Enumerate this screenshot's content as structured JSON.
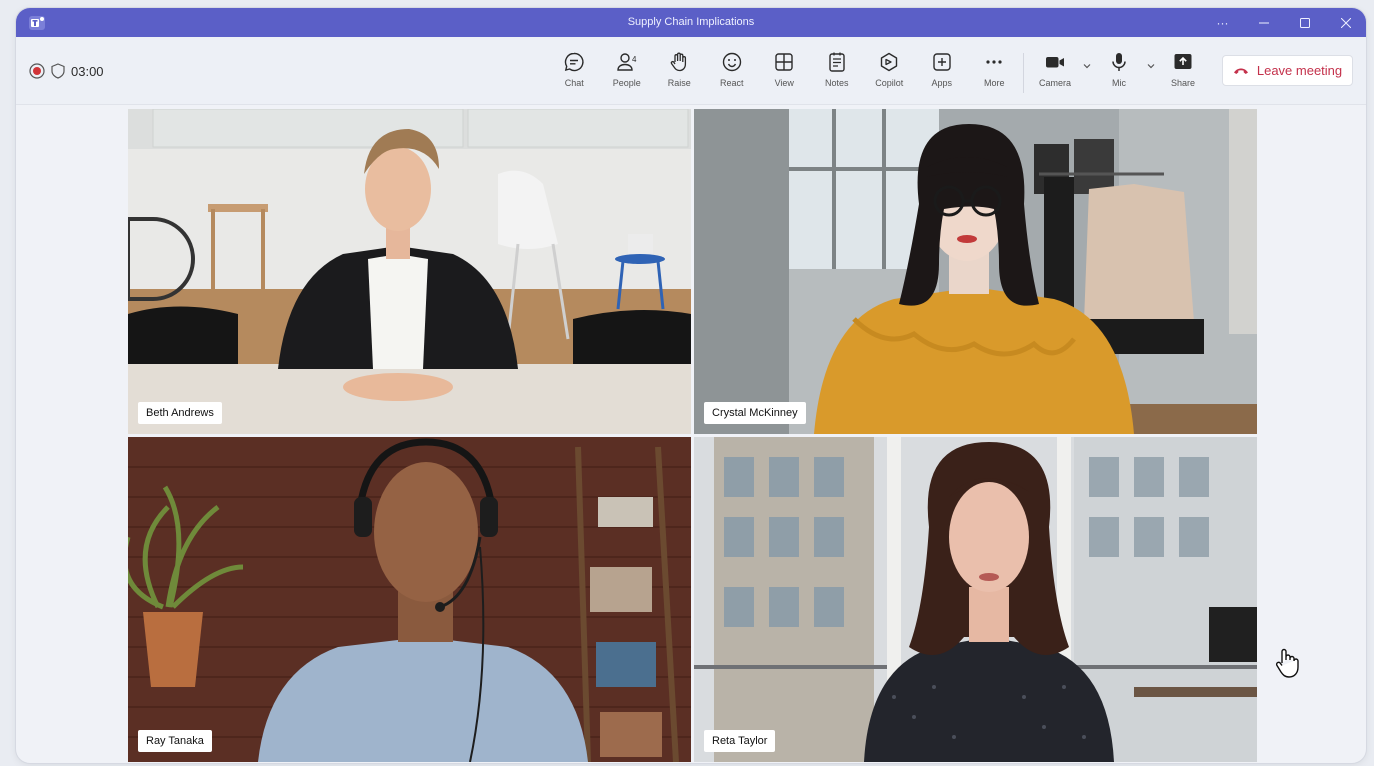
{
  "window": {
    "title": "Supply Chain Implications",
    "controls": [
      "more-icon",
      "minimize-icon",
      "maximize-icon",
      "close-icon"
    ]
  },
  "recording": {
    "timer": "03:00"
  },
  "toolbar": {
    "items": [
      {
        "label": "Chat",
        "icon": "chat-icon"
      },
      {
        "label": "People",
        "icon": "people-icon",
        "badge": "4"
      },
      {
        "label": "Raise",
        "icon": "raise-hand-icon"
      },
      {
        "label": "React",
        "icon": "react-icon"
      },
      {
        "label": "View",
        "icon": "view-icon"
      },
      {
        "label": "Notes",
        "icon": "notes-icon"
      },
      {
        "label": "Copilot",
        "icon": "copilot-icon"
      },
      {
        "label": "Apps",
        "icon": "apps-icon"
      },
      {
        "label": "More",
        "icon": "more-icon"
      }
    ],
    "media": [
      {
        "label": "Camera",
        "icon": "camera-icon"
      },
      {
        "label": "Mic",
        "icon": "mic-icon"
      },
      {
        "label": "Share",
        "icon": "share-icon"
      }
    ],
    "leave_label": "Leave meeting"
  },
  "participants": [
    {
      "name": "Beth Andrews"
    },
    {
      "name": "Crystal McKinney"
    },
    {
      "name": "Ray Tanaka"
    },
    {
      "name": "Reta Taylor"
    }
  ],
  "colors": {
    "brand": "#5b5fc7",
    "leave": "#c4314b",
    "record": "#d13438"
  }
}
